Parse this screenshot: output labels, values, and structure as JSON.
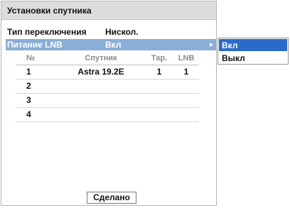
{
  "panel": {
    "title": "Установки спутника",
    "switch_type": {
      "label": "Тип переключения",
      "value": "Нискол."
    },
    "lnb_power": {
      "label": "Питание LNB",
      "value": "Вкл"
    }
  },
  "table": {
    "headers": {
      "num": "№",
      "satellite": "Спутник",
      "tar": "Тар.",
      "lnb": "LNB"
    },
    "rows": [
      {
        "num": "1",
        "satellite": "Astra 19.2E",
        "tar": "1",
        "lnb": "1"
      },
      {
        "num": "2",
        "satellite": "",
        "tar": "",
        "lnb": ""
      },
      {
        "num": "3",
        "satellite": "",
        "tar": "",
        "lnb": ""
      },
      {
        "num": "4",
        "satellite": "",
        "tar": "",
        "lnb": ""
      }
    ]
  },
  "done_label": "Сделано",
  "dropdown": {
    "options": [
      "Вкл",
      "Выкл"
    ],
    "selected": "Вкл"
  },
  "colors": {
    "selected_row": "#8aaed8",
    "selected_option": "#2a6ac8",
    "title_bar": "#dcdcdc"
  }
}
